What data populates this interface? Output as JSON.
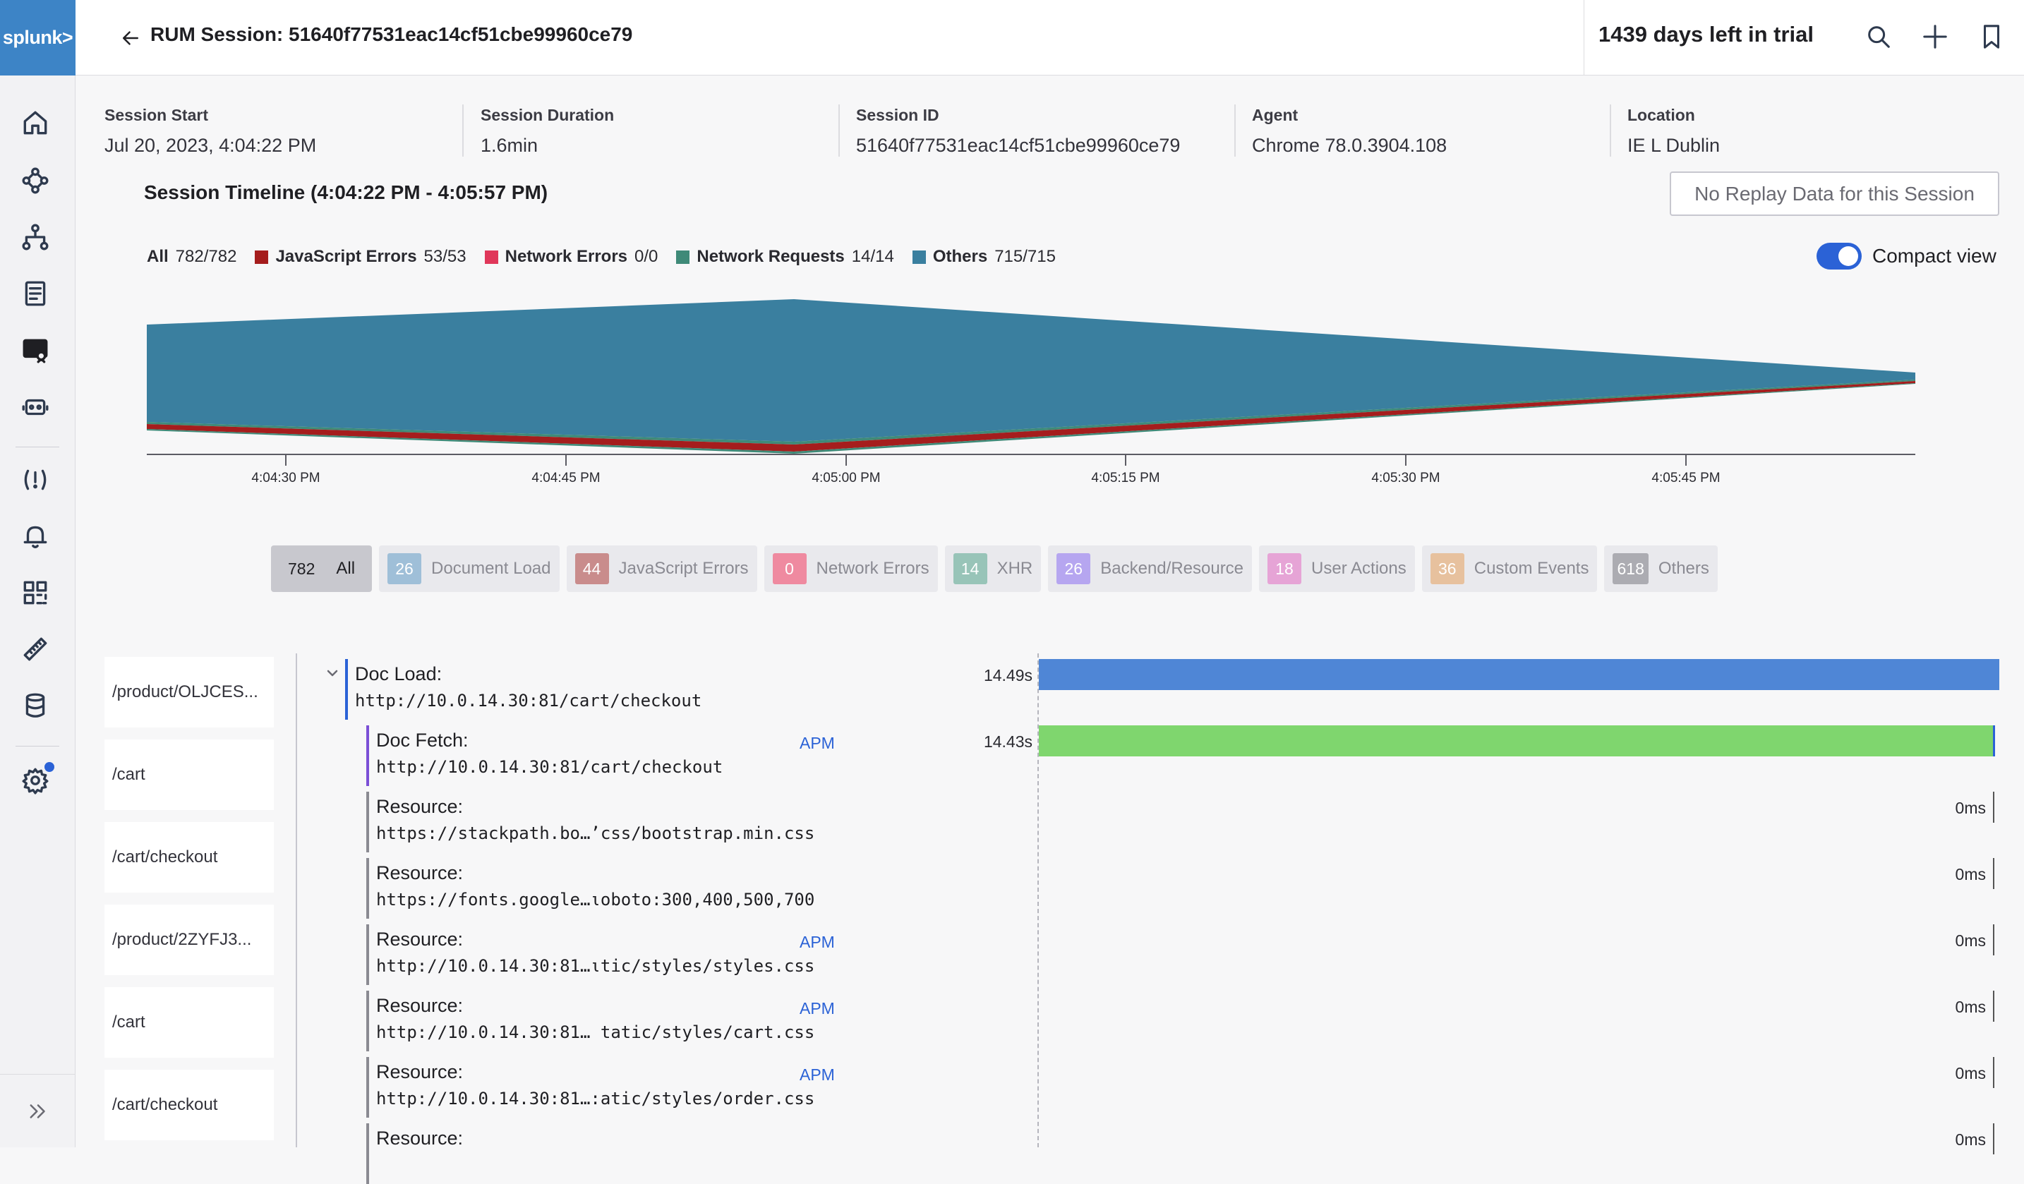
{
  "app": {
    "logo_text": "splunk>"
  },
  "header": {
    "title": "RUM Session: 51640f77531eac14cf51cbe99960ce79",
    "trial": "1439 days left in trial"
  },
  "meta": {
    "session_start_label": "Session Start",
    "session_start_value": "Jul 20, 2023, 4:04:22 PM",
    "session_duration_label": "Session Duration",
    "session_duration_value": "1.6min",
    "session_id_label": "Session ID",
    "session_id_value": "51640f77531eac14cf51cbe99960ce79",
    "agent_label": "Agent",
    "agent_value": "Chrome 78.0.3904.108",
    "location_label": "Location",
    "location_value": "IE L Dublin"
  },
  "timeline": {
    "title": "Session Timeline (4:04:22 PM - 4:05:57 PM)",
    "replay_button": "No Replay Data for this Session",
    "compact_label": "Compact view",
    "compact_on": true
  },
  "legend": [
    {
      "name": "All",
      "count": "782/782",
      "color": ""
    },
    {
      "name": "JavaScript Errors",
      "count": "53/53",
      "color": "#a51d1d"
    },
    {
      "name": "Network Errors",
      "count": "0/0",
      "color": "#e0375a"
    },
    {
      "name": "Network Requests",
      "count": "14/14",
      "color": "#3f8a78"
    },
    {
      "name": "Others",
      "count": "715/715",
      "color": "#3a7f9f"
    }
  ],
  "chart_data": {
    "type": "area",
    "x": [
      "4:04:22 PM",
      "4:04:45 PM",
      "4:05:00 PM",
      "4:05:57 PM"
    ],
    "xticks": [
      "4:04:30 PM",
      "4:04:45 PM",
      "4:05:00 PM",
      "4:05:15 PM",
      "4:05:30 PM",
      "4:05:45 PM"
    ],
    "series": [
      {
        "name": "JavaScript Errors",
        "color": "#a51d1d"
      },
      {
        "name": "Network Requests",
        "color": "#3f8a78"
      },
      {
        "name": "Others",
        "color": "#3a7f9f"
      }
    ],
    "title": "",
    "xlabel": "",
    "ylabel": ""
  },
  "chips": [
    {
      "count": "782",
      "label": "All",
      "color": "",
      "active": true
    },
    {
      "count": "26",
      "label": "Document Load",
      "color": "#9fbfd8",
      "active": false
    },
    {
      "count": "44",
      "label": "JavaScript Errors",
      "color": "#c98c8c",
      "active": false
    },
    {
      "count": "0",
      "label": "Network Errors",
      "color": "#ef8aa0",
      "active": false
    },
    {
      "count": "14",
      "label": "XHR",
      "color": "#98c4b8",
      "active": false
    },
    {
      "count": "26",
      "label": "Backend/Resource",
      "color": "#b6a6f0",
      "active": false
    },
    {
      "count": "18",
      "label": "User Actions",
      "color": "#e6a4d6",
      "active": false
    },
    {
      "count": "36",
      "label": "Custom Events",
      "color": "#e7c19e",
      "active": false
    },
    {
      "count": "618",
      "label": "Others",
      "color": "#acacb2",
      "active": false
    }
  ],
  "pages": [
    "/product/OLJCES...",
    "/cart",
    "/cart/checkout",
    "/product/2ZYFJ3...",
    "/cart",
    "/cart/checkout"
  ],
  "events": [
    {
      "title": "Doc Load:",
      "url": "http://10.0.14.30:81/cart/checkout",
      "apm": "",
      "duration": "14.49s",
      "color": "#2b62d6"
    },
    {
      "title": "Doc Fetch:",
      "url": "http://10.0.14.30:81/cart/checkout",
      "apm": "APM",
      "duration": "14.43s",
      "color": "#7b4fd6"
    },
    {
      "title": "Resource:",
      "url": "https://stackpath.bo…’css/bootstrap.min.css",
      "apm": "",
      "duration": "0ms",
      "color": "#8a8a92"
    },
    {
      "title": "Resource:",
      "url": "https://fonts.google…ιoboto:300,400,500,700",
      "apm": "",
      "duration": "0ms",
      "color": "#8a8a92"
    },
    {
      "title": "Resource:",
      "url": "http://10.0.14.30:81…ιtic/styles/styles.css",
      "apm": "APM",
      "duration": "0ms",
      "color": "#8a8a92"
    },
    {
      "title": "Resource:",
      "url": "http://10.0.14.30:81… tatic/styles/cart.css",
      "apm": "APM",
      "duration": "0ms",
      "color": "#8a8a92"
    },
    {
      "title": "Resource:",
      "url": "http://10.0.14.30:81…:atic/styles/order.css",
      "apm": "APM",
      "duration": "0ms",
      "color": "#8a8a92"
    },
    {
      "title": "Resource:",
      "url": "",
      "apm": "",
      "duration": "0ms",
      "color": "#8a8a92"
    }
  ]
}
